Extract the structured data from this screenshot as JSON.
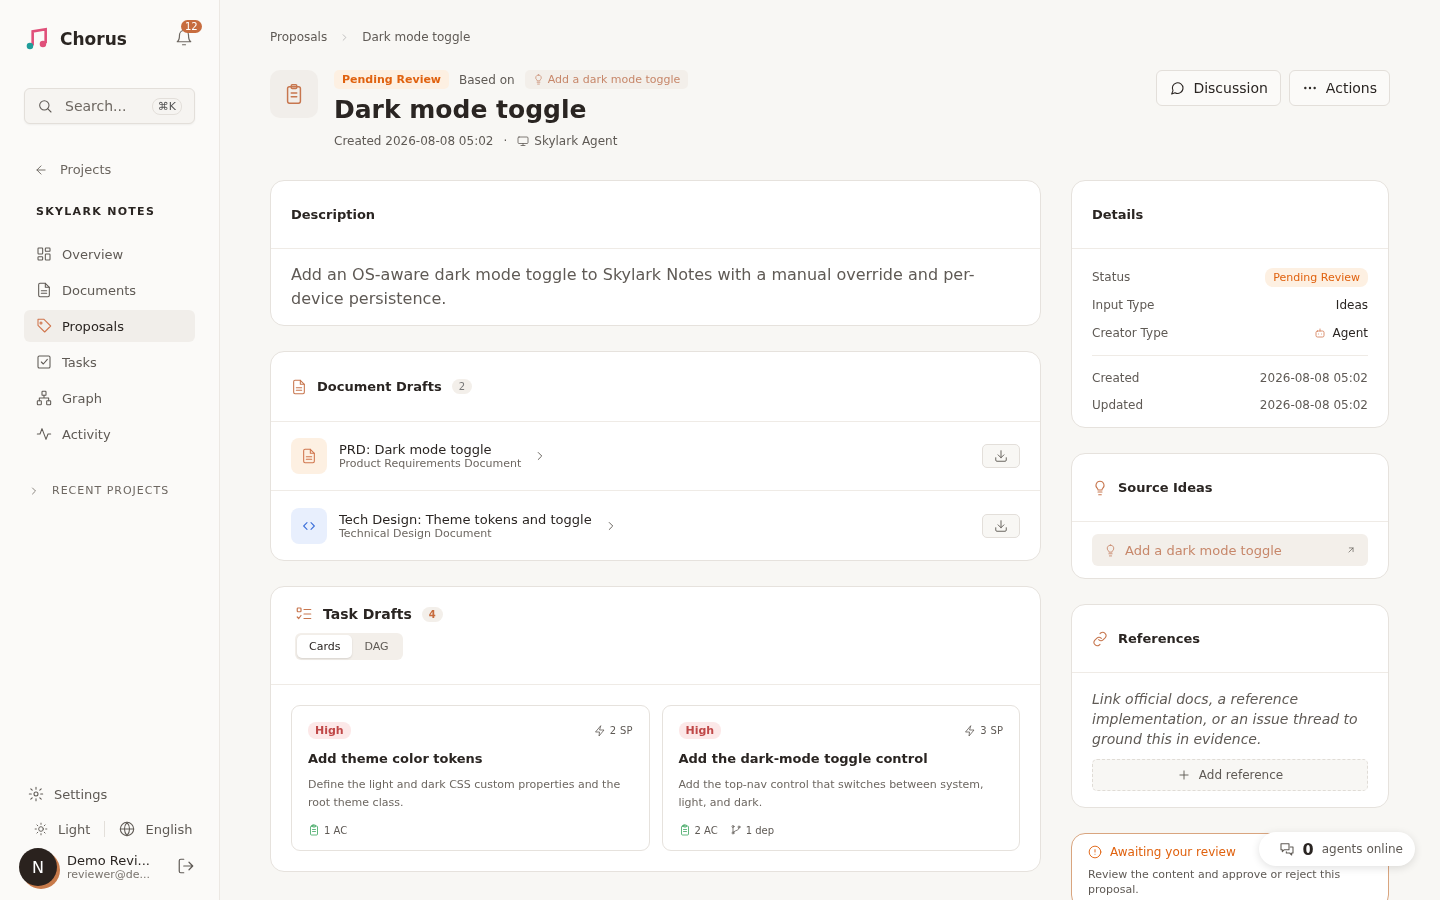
{
  "sidebar": {
    "brand": "Chorus",
    "notifications": "12",
    "search": {
      "placeholder": "Search...",
      "shortcut": "⌘K"
    },
    "back": "Projects",
    "project": "SKYLARK NOTES",
    "items": [
      {
        "label": "Overview",
        "selected": false
      },
      {
        "label": "Documents",
        "selected": false
      },
      {
        "label": "Proposals",
        "selected": true
      },
      {
        "label": "Tasks",
        "selected": false
      },
      {
        "label": "Graph",
        "selected": false
      },
      {
        "label": "Activity",
        "selected": false
      }
    ],
    "recent": {
      "label": "RECENT PROJECTS",
      "expanded": false
    },
    "settings": "Settings",
    "theme": "Light",
    "language": "English",
    "user": {
      "initial": "N",
      "name": "Demo Revi...",
      "email": "reviewer@de..."
    }
  },
  "breadcrumb": [
    "Proposals",
    "Dark mode toggle"
  ],
  "header": {
    "status": "Pending Review",
    "based_on": "Based on",
    "idea": "Add a dark mode toggle",
    "title": "Dark mode toggle",
    "created": "Created 2026-08-08 05:02",
    "separator": "·",
    "author": "Skylark Agent",
    "buttons": [
      "Discussion",
      "Actions"
    ]
  },
  "description": {
    "title": "Description",
    "text": "Add an OS-aware dark mode toggle to Skylark Notes with a manual override and per-device persistence."
  },
  "document_drafts": {
    "title": "Document Drafts",
    "count": "2",
    "items": [
      {
        "title": "PRD: Dark mode toggle",
        "subtitle": "Product Requirements Document",
        "kind": "prd"
      },
      {
        "title": "Tech Design: Theme tokens and toggle",
        "subtitle": "Technical Design Document",
        "kind": "tech"
      }
    ]
  },
  "task_drafts": {
    "title": "Task Drafts",
    "count": "4",
    "tabs": [
      {
        "label": "Cards",
        "selected": true
      },
      {
        "label": "DAG",
        "selected": false
      }
    ],
    "cards": [
      {
        "priority": "High",
        "points": "2",
        "unit": "SP",
        "title": "Add theme color tokens",
        "text": "Define the light and dark CSS custom properties and the root theme class.",
        "ac": "1 AC"
      },
      {
        "priority": "High",
        "points": "3",
        "unit": "SP",
        "title": "Add the dark-mode toggle control",
        "text": "Add the top-nav control that switches between system, light, and dark.",
        "ac": "2 AC",
        "deps": "1 dep"
      }
    ]
  },
  "details": {
    "title": "Details",
    "rows": [
      {
        "label": "Status",
        "value": "Pending Review",
        "kind": "badge"
      },
      {
        "label": "Input Type",
        "value": "Ideas",
        "kind": "text"
      },
      {
        "label": "Creator Type",
        "value": "Agent",
        "kind": "agent"
      },
      {
        "label": "Created",
        "value": "2026-08-08 05:02",
        "kind": "date"
      },
      {
        "label": "Updated",
        "value": "2026-08-08 05:02",
        "kind": "date"
      }
    ]
  },
  "source_ideas": {
    "title": "Source Ideas",
    "items": [
      "Add a dark mode toggle"
    ]
  },
  "references": {
    "title": "References",
    "empty_text": "Link official docs, a reference implementation, or an issue thread to ground this in evidence.",
    "add": "Add reference"
  },
  "review": {
    "title": "Awaiting your review",
    "text": "Review the content and approve or reject this proposal."
  },
  "presence": {
    "count": "0",
    "label": "agents online"
  }
}
